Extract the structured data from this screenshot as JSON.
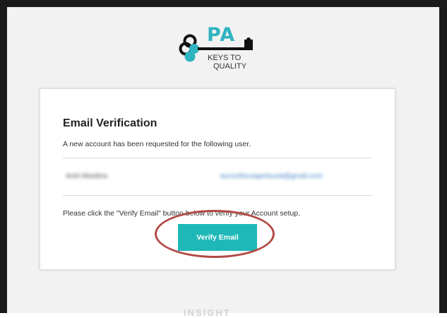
{
  "logo": {
    "brand": "PA",
    "line1": "KEYS TO",
    "line2": "QUALITY",
    "accent_color": "#2fb3c0"
  },
  "card": {
    "title": "Email Verification",
    "subtitle": "A new account has been requested for the following user.",
    "user": {
      "name": "Ariel Abedina",
      "email": "accordiscoapintuoat@gmail.com"
    },
    "instruction": "Please click the \"Verify Email\" button below to verify your Account setup.",
    "verify_button_label": "Verify Email",
    "button_color": "#1fb8b8"
  },
  "annotation": {
    "color": "#b24a45"
  },
  "watermark": "INSIGHT"
}
